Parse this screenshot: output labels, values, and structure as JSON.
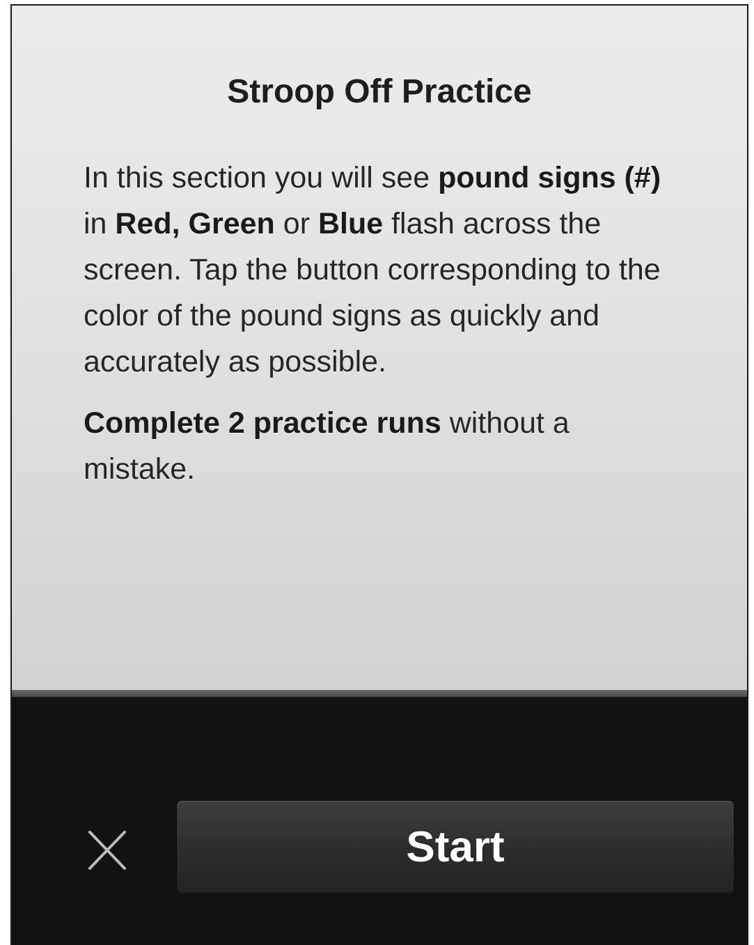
{
  "screen": {
    "title": "Stroop Off Practice"
  },
  "instructions": {
    "p1_a": "In this section you will see ",
    "p1_b": "pound signs (#)",
    "p1_c": " in ",
    "p1_d": "Red, Green",
    "p1_e": " or ",
    "p1_f": "Blue",
    "p1_g": " flash across the screen. Tap the button corresponding to the color of the pound signs as quickly and accurately as possible.",
    "p2_a": "Complete 2 practice runs",
    "p2_b": " without a mistake."
  },
  "footer": {
    "close_icon": "close-x",
    "start_label": "Start"
  },
  "colors": {
    "panel_bg": "#e2e2e2",
    "footer_bg": "#121212",
    "button_bg": "#2c2c2c",
    "text": "#262626"
  }
}
